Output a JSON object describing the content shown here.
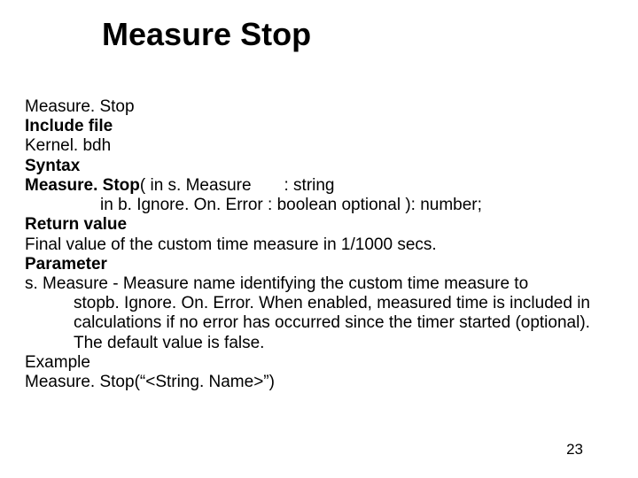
{
  "title": "Measure Stop",
  "lines": {
    "l1": "Measure. Stop",
    "l2": "Include file",
    "l3": "Kernel. bdh",
    "l4": "Syntax",
    "syntax_a": "Measure. Stop",
    "syntax_b": "( in s. Measure",
    "syntax_c": ": string",
    "syntax2": "in b. Ignore. On. Error : boolean optional ): number;",
    "l6": "Return value",
    "l7": "Final value of the custom time measure in 1/1000 secs.",
    "l8": "Parameter",
    "l9": "s. Measure - Measure name identifying the custom time measure to",
    "l10": "stopb. Ignore. On. Error. When enabled, measured time is included in",
    "l11": "calculations if no error has occurred since the timer started (optional).",
    "l12": "The default value is false.",
    "l13": "Example",
    "l14": "Measure. Stop(“<String. Name>”)"
  },
  "page_number": "23"
}
